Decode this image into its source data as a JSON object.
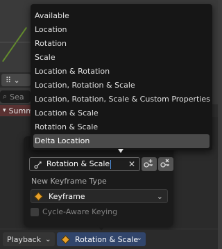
{
  "menu": {
    "items": [
      {
        "label": "Available"
      },
      {
        "label": "Location"
      },
      {
        "label": "Rotation"
      },
      {
        "label": "Scale"
      },
      {
        "label": "Location & Rotation"
      },
      {
        "label": "Location, Rotation & Scale"
      },
      {
        "label": "Location, Rotation, Scale & Custom Properties"
      },
      {
        "label": "Location & Scale"
      },
      {
        "label": "Rotation & Scale"
      },
      {
        "label": "Delta Location"
      }
    ],
    "highlighted": "Delta Location"
  },
  "background": {
    "search_placeholder": "Sea",
    "summary_label": "Summ"
  },
  "popover": {
    "keying_set_value": "Rotation & Scale",
    "new_keyframe_type_label": "New Keyframe Type",
    "keyframe_type_value": "Keyframe",
    "cycle_aware_label": "Cycle-Aware Keying",
    "cycle_aware_checked": false
  },
  "bottom_bar": {
    "playback_label": "Playback",
    "active_keying_set_label": "Rotation & Scale"
  },
  "colors": {
    "keyframe_diamond": "#e8a02a",
    "active_button": "#31456b",
    "summary_channel": "#5a3232"
  }
}
